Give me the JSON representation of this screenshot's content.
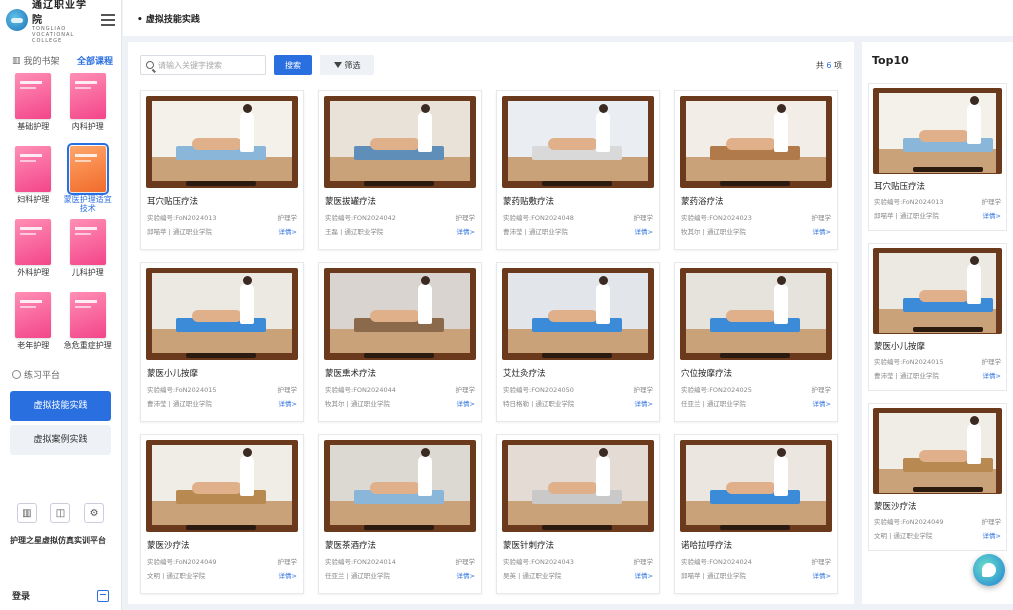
{
  "sidebar": {
    "logo": {
      "cn": "通辽职业学院",
      "en": "TONGLIAO VOCATIONAL COLLEGE"
    },
    "shelf_title": "我的书架",
    "shelf_all": "全部课程",
    "books": [
      {
        "label": "基础护理"
      },
      {
        "label": "内科护理"
      },
      {
        "label": "妇科护理"
      },
      {
        "label": "蒙医护理适宜技术"
      },
      {
        "label": "外科护理"
      },
      {
        "label": "儿科护理"
      },
      {
        "label": "老年护理"
      },
      {
        "label": "急危重症护理"
      }
    ],
    "practice_title": "练习平台",
    "nav": [
      {
        "label": "虚拟技能实践"
      },
      {
        "label": "虚拟案例实践"
      }
    ],
    "platform_name": "护理之星虚拟仿真实训平台",
    "login": "登录"
  },
  "topbar": {
    "breadcrumb": "• 虚拟技能实践"
  },
  "toolbar": {
    "search_placeholder": "请输入关键字搜索",
    "search_btn": "搜索",
    "filter_btn": "筛选",
    "count_prefix": "共",
    "count": "6",
    "count_suffix": "项"
  },
  "cards": [
    {
      "title": "耳穴贴压疗法",
      "code": "实验编号:FoN2024013",
      "category": "护理学",
      "author": "邱喵苹 | 通辽职业学院",
      "detail": "详情>"
    },
    {
      "title": "蒙医拔罐疗法",
      "code": "实验编号:FON2024042",
      "category": "护理学",
      "author": "王磊 | 通辽职业学院",
      "detail": "详情>"
    },
    {
      "title": "蒙药贴敷疗法",
      "code": "实验编号:FON2024048",
      "category": "护理学",
      "author": "曹沛莹 | 通辽职业学院",
      "detail": "详情>"
    },
    {
      "title": "蒙药浴疗法",
      "code": "实验编号:FON2024023",
      "category": "护理学",
      "author": "牧其尔 | 通辽职业学院",
      "detail": "详情>"
    },
    {
      "title": "蒙医小儿按摩",
      "code": "实验编号:FoN2024015",
      "category": "护理学",
      "author": "曹沛莹 | 通辽职业学院",
      "detail": "详情>"
    },
    {
      "title": "蒙医熏术疗法",
      "code": "实验编号:FON2024044",
      "category": "护理学",
      "author": "牧其尔 | 通辽职业学院",
      "detail": "详情>"
    },
    {
      "title": "艾灶灸疗法",
      "code": "实验编号:FON2024050",
      "category": "护理学",
      "author": "特日格勒 | 通辽职业学院",
      "detail": "详情>"
    },
    {
      "title": "穴位按摩疗法",
      "code": "实验编号:FON2024025",
      "category": "护理学",
      "author": "任亚兰 | 通辽职业学院",
      "detail": "详情>"
    },
    {
      "title": "蒙医沙疗法",
      "code": "实验编号:FoN2024049",
      "category": "护理学",
      "author": "文明 | 通辽职业学院",
      "detail": "详情>"
    },
    {
      "title": "蒙医茶酒疗法",
      "code": "实验编号:FON2024014",
      "category": "护理学",
      "author": "任亚兰 | 通辽职业学院",
      "detail": "详情>"
    },
    {
      "title": "蒙医针刺疗法",
      "code": "实验编号:FON2024043",
      "category": "护理学",
      "author": "吴英 | 通辽职业学院",
      "detail": "详情>"
    },
    {
      "title": "诺哈拉呼疗法",
      "code": "实验编号:FON2024024",
      "category": "护理学",
      "author": "邱喵苹 | 通辽职业学院",
      "detail": "详情>"
    }
  ],
  "top10": {
    "title": "Top10",
    "items": [
      {
        "title": "耳穴贴压疗法",
        "code": "实验编号:FoN2024013",
        "category": "护理学",
        "author": "邱喵苹 | 通辽职业学院",
        "detail": "详情>"
      },
      {
        "title": "蒙医小儿按摩",
        "code": "实验编号:FoN2024015",
        "category": "护理学",
        "author": "曹沛莹 | 通辽职业学院",
        "detail": "详情>"
      },
      {
        "title": "蒙医沙疗法",
        "code": "实验编号:FoN2024049",
        "category": "护理学",
        "author": "文明 | 通辽职业学院",
        "detail": "详情>"
      }
    ]
  },
  "colors": {
    "accent": "#2a6fe0",
    "thumb_frame": "#6b3a1c",
    "book_pink": "#f3458a",
    "book_orange": "#f06b2a"
  },
  "icons": [
    "menu-icon",
    "book-icon",
    "gear-icon",
    "search-icon",
    "filter-icon",
    "logout-icon",
    "assistant-icon"
  ]
}
